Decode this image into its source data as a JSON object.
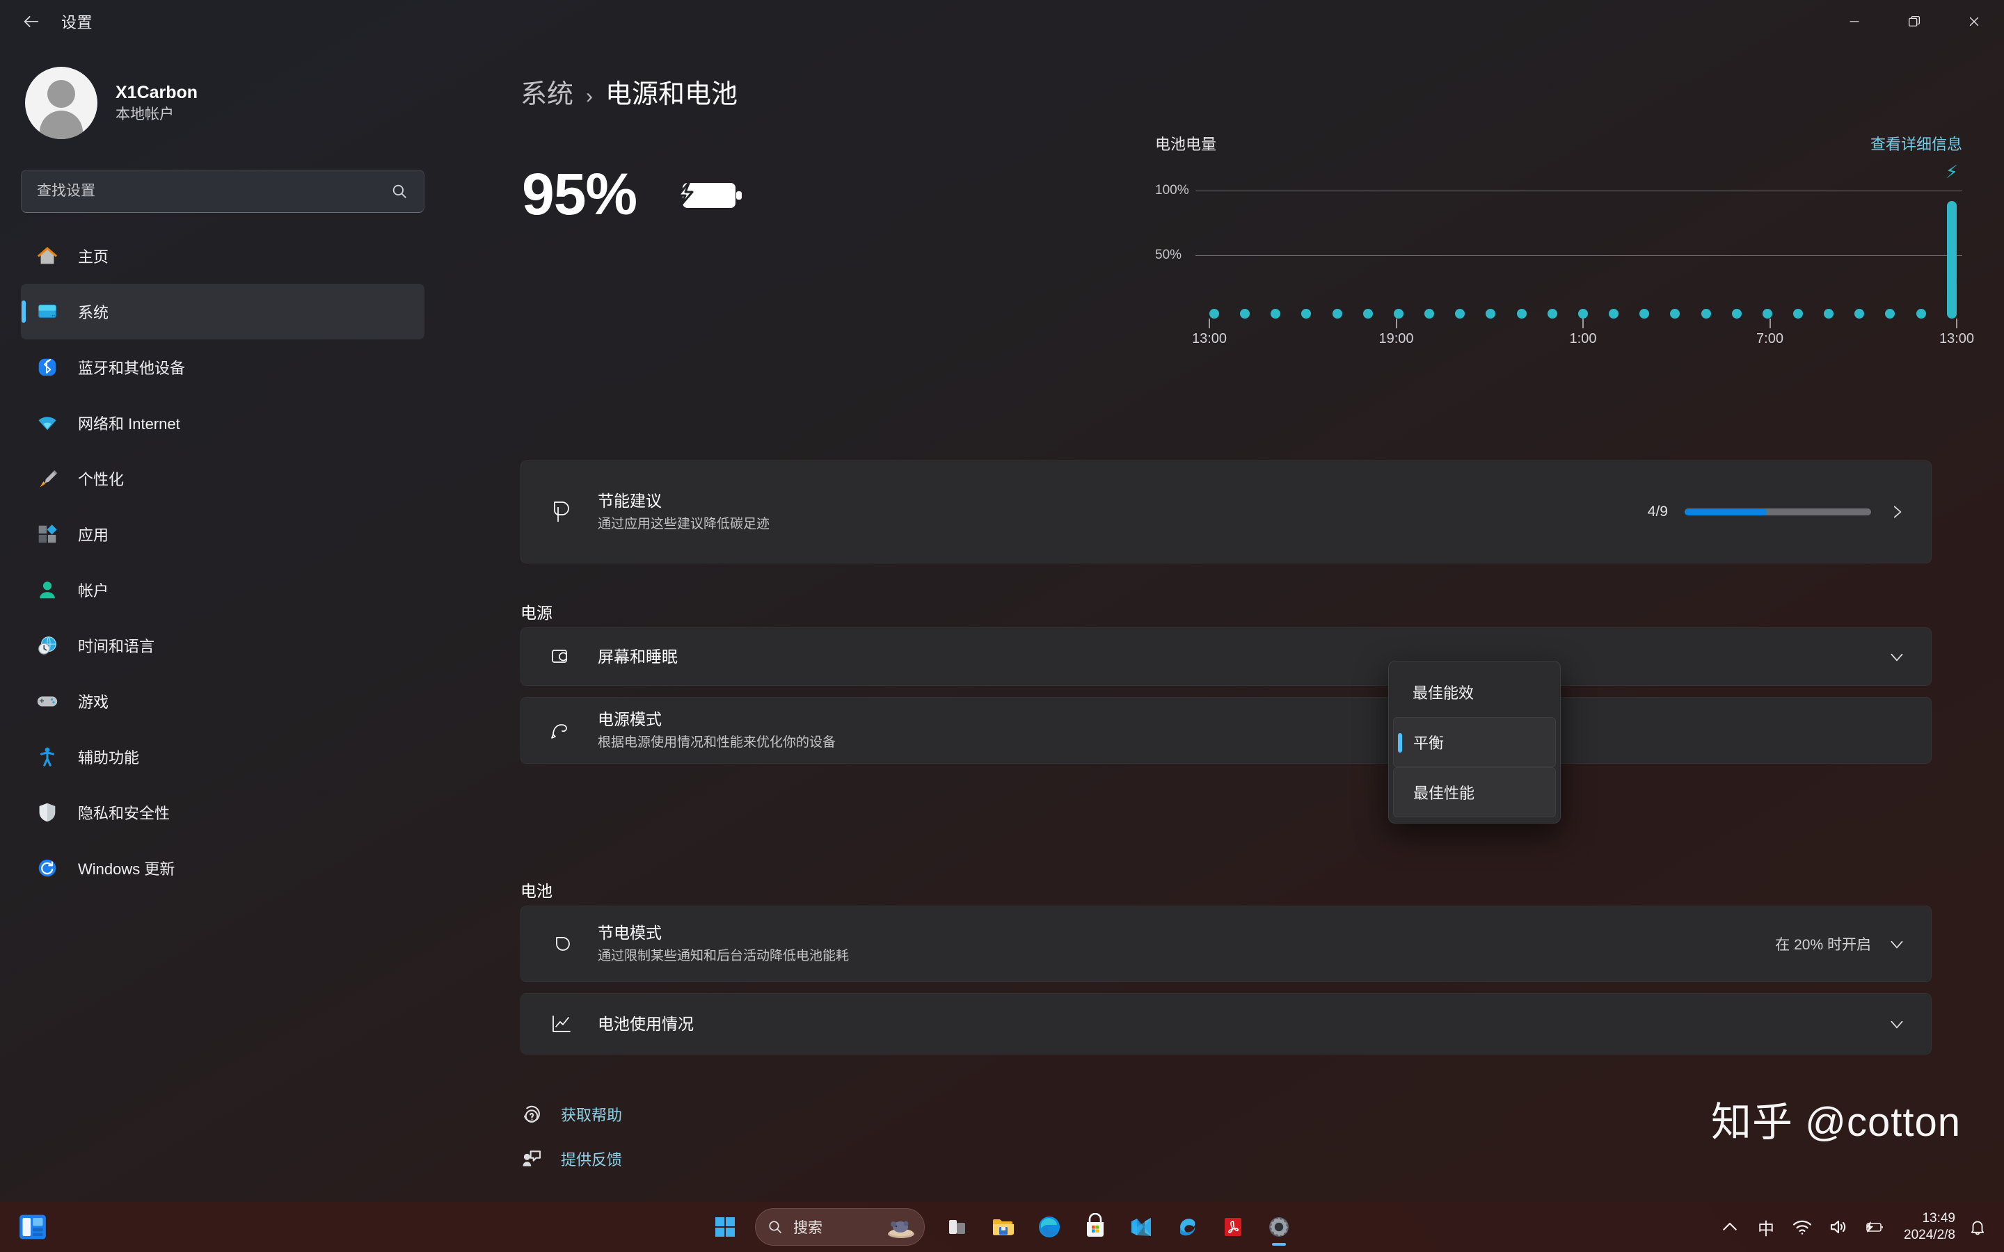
{
  "window": {
    "title": "设置",
    "back_icon": "back-arrow-icon",
    "controls": {
      "minimize": "minimize-icon",
      "restore": "restore-icon",
      "close": "close-icon"
    }
  },
  "sidebar": {
    "account": {
      "name": "X1Carbon",
      "type": "本地帐户"
    },
    "search": {
      "placeholder": "查找设置",
      "value": "",
      "icon": "search-icon"
    },
    "items": [
      {
        "label": "主页",
        "icon": "home-icon",
        "active": false
      },
      {
        "label": "系统",
        "icon": "system-monitor-icon",
        "active": true
      },
      {
        "label": "蓝牙和其他设备",
        "icon": "bluetooth-icon",
        "active": false
      },
      {
        "label": "网络和 Internet",
        "icon": "wifi-icon",
        "active": false
      },
      {
        "label": "个性化",
        "icon": "paintbrush-icon",
        "active": false
      },
      {
        "label": "应用",
        "icon": "apps-icon",
        "active": false
      },
      {
        "label": "帐户",
        "icon": "account-person-icon",
        "active": false
      },
      {
        "label": "时间和语言",
        "icon": "clock-globe-icon",
        "active": false
      },
      {
        "label": "游戏",
        "icon": "gamepad-icon",
        "active": false
      },
      {
        "label": "辅助功能",
        "icon": "accessibility-icon",
        "active": false
      },
      {
        "label": "隐私和安全性",
        "icon": "shield-icon",
        "active": false
      },
      {
        "label": "Windows 更新",
        "icon": "update-sync-icon",
        "active": false
      }
    ]
  },
  "main": {
    "breadcrumb": {
      "parent": "系统",
      "separator": "›",
      "current": "电源和电池"
    },
    "hero": {
      "percent": "95%",
      "battery_icon": "battery-charging-icon"
    },
    "chart_data": {
      "type": "bar",
      "title": "电池电量",
      "link_label": "查看详细信息",
      "xlabel": "",
      "ylabel": "",
      "ylim": [
        0,
        110
      ],
      "ytick_labels": [
        "100%",
        "50%"
      ],
      "ytick_values": [
        100,
        50
      ],
      "grid": true,
      "legend": "none",
      "xtick_labels": [
        "13:00",
        "19:00",
        "1:00",
        "7:00",
        "13:00"
      ],
      "xtick_positions": [
        0,
        6,
        12,
        18,
        24
      ],
      "categories": [
        "13:00",
        "14:00",
        "15:00",
        "16:00",
        "17:00",
        "18:00",
        "19:00",
        "20:00",
        "21:00",
        "22:00",
        "23:00",
        "0:00",
        "1:00",
        "2:00",
        "3:00",
        "4:00",
        "5:00",
        "6:00",
        "7:00",
        "8:00",
        "9:00",
        "10:00",
        "11:00",
        "12:00",
        "13:00"
      ],
      "values": [
        2,
        2,
        2,
        2,
        2,
        2,
        2,
        2,
        2,
        2,
        2,
        2,
        2,
        2,
        2,
        2,
        2,
        2,
        2,
        2,
        2,
        2,
        2,
        2,
        95
      ],
      "bar_color": "#2eb9c9",
      "charging_marker": {
        "icon": "lightning-bolt-icon",
        "at_index": 24
      }
    },
    "suggestion_card": {
      "icon": "leaf-icon",
      "title": "节能建议",
      "subtitle": "通过应用这些建议降低碳足迹",
      "progress_text": "4/9",
      "progress_percent": 44,
      "chevron": "chevron-right-icon"
    },
    "power_section": {
      "heading": "电源",
      "rows": [
        {
          "icon": "screen-sleep-icon",
          "title": "屏幕和睡眠",
          "subtitle": "",
          "value": "",
          "chevron": "chevron-down-icon"
        },
        {
          "icon": "power-mode-icon",
          "title": "电源模式",
          "subtitle": "根据电源使用情况和性能来优化你的设备",
          "value": "",
          "chevron": "chevron-down-icon"
        }
      ]
    },
    "battery_section": {
      "heading": "电池",
      "rows": [
        {
          "icon": "battery-saver-icon",
          "title": "节电模式",
          "subtitle": "通过限制某些通知和后台活动降低电池能耗",
          "value": "在 20% 时开启",
          "chevron": "chevron-down-icon"
        },
        {
          "icon": "battery-usage-chart-icon",
          "title": "电池使用情况",
          "subtitle": "",
          "value": "",
          "chevron": "chevron-down-icon"
        }
      ]
    },
    "power_mode_flyout": {
      "options": [
        {
          "label": "最佳能效",
          "state": "normal"
        },
        {
          "label": "平衡",
          "state": "selected"
        },
        {
          "label": "最佳性能",
          "state": "hover"
        }
      ]
    },
    "footer_links": [
      {
        "icon": "help-question-icon",
        "label": "获取帮助"
      },
      {
        "icon": "feedback-icon",
        "label": "提供反馈"
      }
    ]
  },
  "watermark": {
    "text": "知乎 @cotton"
  },
  "taskbar": {
    "widget_icon": "widgets-panel-icon",
    "start_icon": "windows-start-icon",
    "search": {
      "placeholder": "搜索",
      "icon": "search-icon",
      "decoration": "mouse-in-basket-icon"
    },
    "apps": [
      {
        "name": "task-view-icon",
        "active": false
      },
      {
        "name": "file-explorer-icon",
        "active": false
      },
      {
        "name": "microsoft-edge-icon",
        "active": false
      },
      {
        "name": "microsoft-store-icon",
        "active": false
      },
      {
        "name": "visual-studio-icon",
        "active": false
      },
      {
        "name": "edge-dev-icon",
        "active": false
      },
      {
        "name": "pdf-reader-icon",
        "active": false
      },
      {
        "name": "settings-gear-icon",
        "active": true
      }
    ],
    "tray": {
      "overflow_icon": "chevron-up-icon",
      "ime_label": "中",
      "wifi_icon": "wifi-icon",
      "volume_icon": "speaker-icon",
      "battery_icon": "battery-charging-icon",
      "time": "13:49",
      "date": "2024/2/8",
      "notification_icon": "bell-icon"
    }
  },
  "colors": {
    "accent": "#4cc2ff",
    "progress": "#0a84e0",
    "chart_bar": "#2eb9c9",
    "link": "#78cbe8",
    "card_bg": "#2b2b2d"
  }
}
